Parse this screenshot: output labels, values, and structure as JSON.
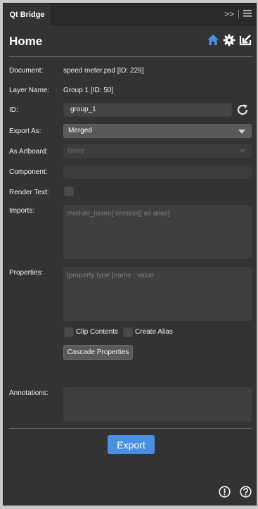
{
  "tab": {
    "label": "Qt Bridge"
  },
  "toolbar": {
    "expand_glyph": ">>"
  },
  "header": {
    "title": "Home"
  },
  "form": {
    "document_label": "Document:",
    "document_value": "speed meter.psd [ID: 229]",
    "layer_label": "Layer Name:",
    "layer_value": "Group 1 [ID: 50]",
    "id_label": "ID:",
    "id_value": "group_1",
    "export_as_label": "Export As:",
    "export_as_value": "Merged",
    "artboard_label": "As Artboard:",
    "artboard_value": "None",
    "component_label": "Component:",
    "component_value": "",
    "render_text_label": "Render Text:",
    "imports_label": "Imports:",
    "imports_placeholder": "module_name[ version][ as alias]",
    "properties_label": "Properties:",
    "properties_placeholder": "[property type ]name : value",
    "clip_contents_label": "Clip Contents",
    "create_alias_label": "Create Alias",
    "cascade_label": "Cascade Properties",
    "annotations_label": "Annotations:"
  },
  "actions": {
    "export_label": "Export"
  },
  "colors": {
    "accent": "#4a90e2",
    "panel": "#333333"
  }
}
